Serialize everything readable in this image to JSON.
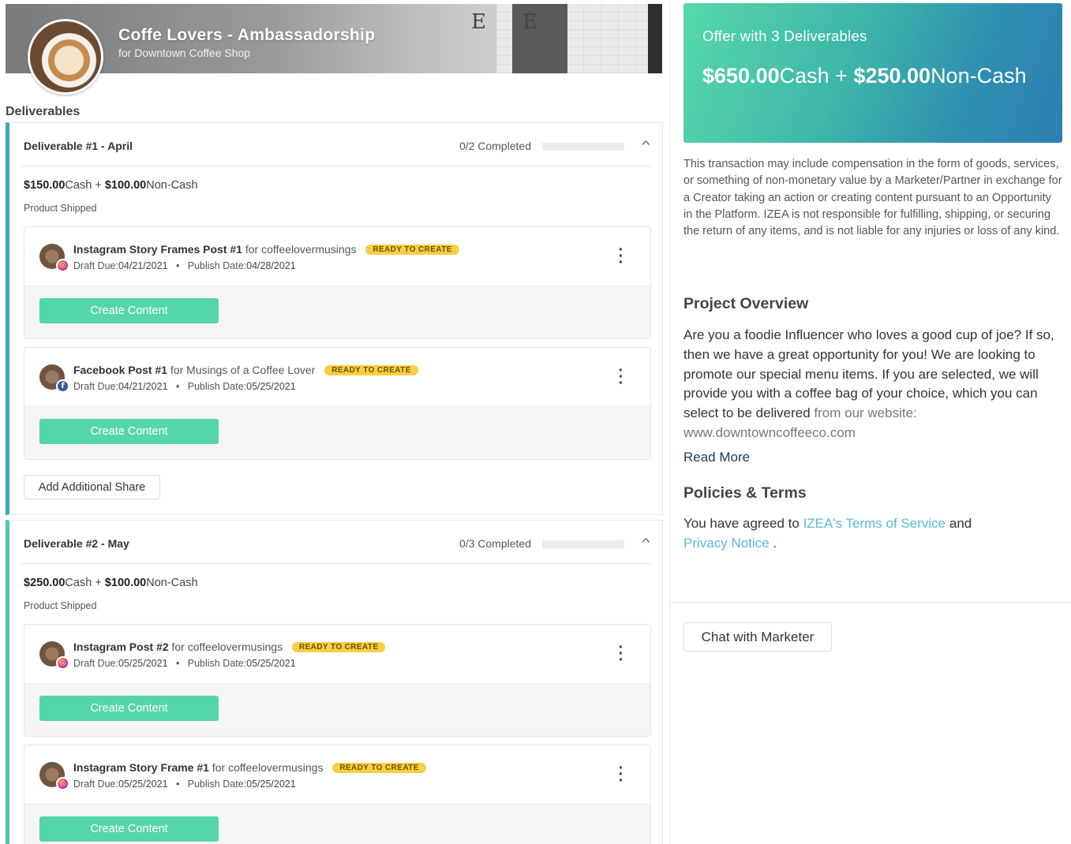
{
  "campaign": {
    "title": "Coffe Lovers - Ambassadorship",
    "subtitle": "for Downtown Coffee Shop"
  },
  "deliverables_heading": "Deliverables",
  "deliverables": [
    {
      "name": "Deliverable #1 - April",
      "progress": "0/2 Completed",
      "progress_fraction": 0,
      "cash": "$150.00",
      "cash_label": "Cash",
      "noncash": "$100.00",
      "noncash_label": "Non-Cash",
      "plus": "+",
      "shipping": "Product Shipped",
      "posts": [
        {
          "title": "Instagram Story Frames Post #1",
          "for_text": "for coffeelovermusings",
          "status": "READY TO CREATE",
          "network_icon": "instagram-icon",
          "draft_label": "Draft Due:",
          "draft_due": "04/21/2021",
          "publish_label": "Publish Date:",
          "publish_date": "04/28/2021",
          "button": "Create Content"
        },
        {
          "title": "Facebook Post #1",
          "for_text": "for Musings of a Coffee Lover",
          "status": "READY TO CREATE",
          "network_icon": "facebook-icon",
          "draft_label": "Draft Due:",
          "draft_due": "04/21/2021",
          "publish_label": "Publish Date:",
          "publish_date": "05/25/2021",
          "button": "Create Content"
        }
      ],
      "add_share": "Add Additional Share"
    },
    {
      "name": "Deliverable #2 - May",
      "progress": "0/3 Completed",
      "progress_fraction": 0,
      "cash": "$250.00",
      "cash_label": "Cash",
      "noncash": "$100.00",
      "noncash_label": "Non-Cash",
      "plus": "+",
      "shipping": "Product Shipped",
      "posts": [
        {
          "title": "Instagram Post #2",
          "for_text": "for coffeelovermusings",
          "status": "READY TO CREATE",
          "network_icon": "instagram-icon",
          "draft_label": "Draft Due:",
          "draft_due": "05/25/2021",
          "publish_label": "Publish Date:",
          "publish_date": "05/25/2021",
          "button": "Create Content"
        },
        {
          "title": "Instagram Story Frame #1",
          "for_text": "for coffeelovermusings",
          "status": "READY TO CREATE",
          "network_icon": "instagram-icon",
          "draft_label": "Draft Due:",
          "draft_due": "05/25/2021",
          "publish_label": "Publish Date:",
          "publish_date": "05/25/2021",
          "button": "Create Content"
        }
      ]
    }
  ],
  "offer": {
    "title": "Offer with 3 Deliverables",
    "cash": "$650.00",
    "cash_label": "Cash",
    "plus": "+",
    "noncash": "$250.00",
    "noncash_label": "Non-Cash"
  },
  "disclaimer": "This transaction may include compensation in the form of goods, services, or something of non-monetary value by a Marketer/Partner in exchange for a Creator taking an action or creating content pursuant to an Opportunity in the Platform. IZEA is not responsible for fulfilling, shipping, or securing the return of any items, and is not liable for any injuries or loss of any kind.",
  "project_overview": {
    "heading": "Project Overview",
    "text": "Are you a foodie Influencer who loves a good cup of joe? If so, then we have a great opportunity for you! We are looking to promote our special menu items. If you are selected, we will provide you with a coffee bag of your choice, which you can select to be delivered",
    "text_faded": "from our website: www.downtowncoffeeco.com",
    "read_more": "Read More"
  },
  "policies": {
    "heading": "Policies & Terms",
    "prefix": "You have agreed to",
    "terms_link": "IZEA's Terms of Service",
    "and": "and",
    "privacy_link": "Privacy Notice",
    "suffix": "."
  },
  "chat_button": "Chat with Marketer",
  "bullet": "•",
  "colors": {
    "accent_green": "#55d6a8",
    "badge_yellow": "#f7ce44",
    "offer_gradient_start": "#57d9ab",
    "offer_gradient_end": "#2c7fb2",
    "link_blue": "#5bb8d9"
  }
}
